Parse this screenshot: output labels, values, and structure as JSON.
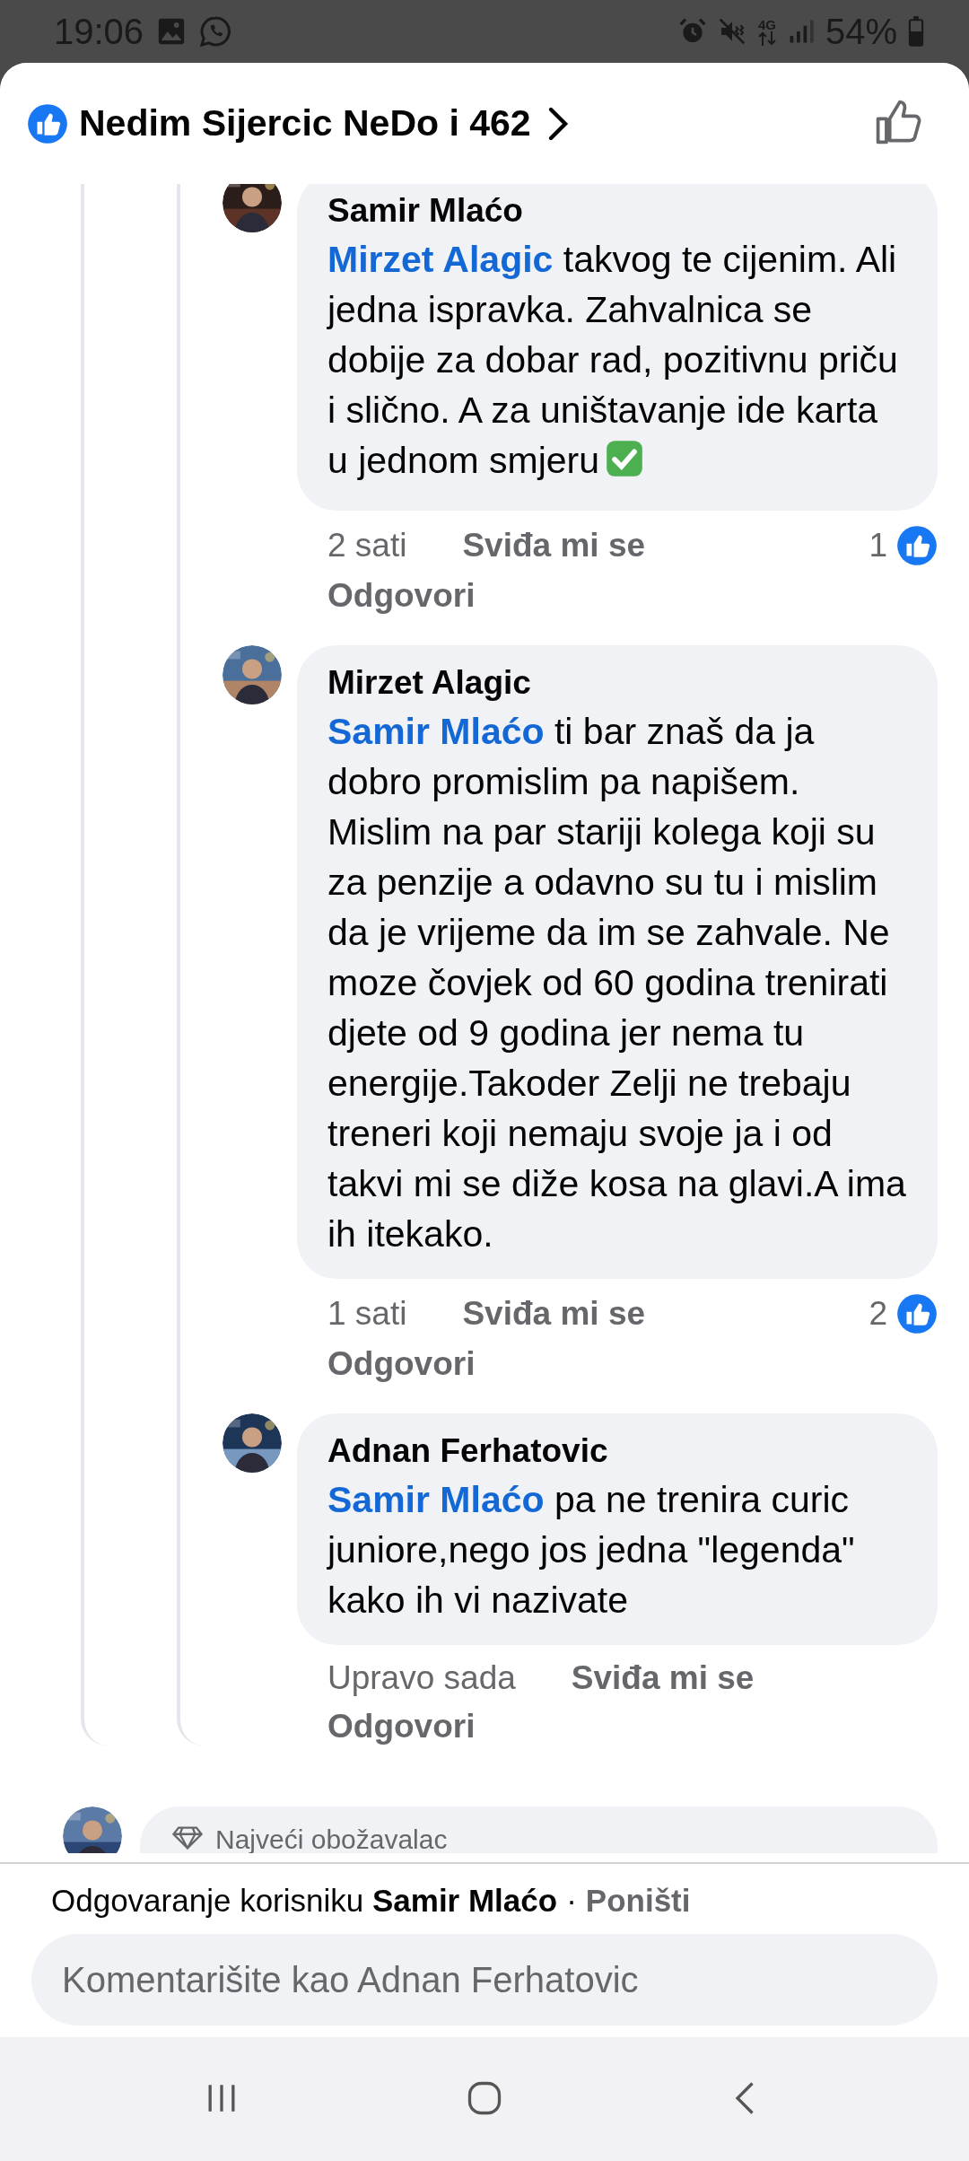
{
  "status_bar": {
    "time": "19:06",
    "network": "4G",
    "battery": "54%"
  },
  "header": {
    "title": "Nedim Sijercic NeDo i 462"
  },
  "comments": [
    {
      "author": "Samir Mlaćo",
      "mention": "Mirzet Alagic",
      "text": " takvog te cijenim. Ali jedna ispravka. Zahvalnica se dobije za dobar rad, pozitivnu priču i slično. A za uništavanje ide karta u jednom smjeru",
      "check_emoji": true,
      "time": "2 sati",
      "like_label": "Sviđa mi se",
      "reply_label": "Odgovori",
      "reactions": "1"
    },
    {
      "author": "Mirzet Alagic",
      "mention": "Samir Mlaćo",
      "text": " ti bar znaš da ja dobro promislim pa napišem. Mislim na par stariji kolega koji su za penzije a odavno su tu i mislim da je vrijeme da im se zahvale. Ne moze čovjek od 60 godina trenirati djete od 9 godina jer nema tu energije.Takoder Zelji ne trebaju treneri koji nemaju svoje ja i od takvi mi se diže kosa na glavi.A ima ih itekako.",
      "check_emoji": false,
      "time": "1 sati",
      "like_label": "Sviđa mi se",
      "reply_label": "Odgovori",
      "reactions": "2"
    },
    {
      "author": "Adnan Ferhatovic",
      "mention": "Samir Mlaćo",
      "text": " pa ne trenira curic juniore,nego jos jedna \"legenda\" kako ih vi nazivate",
      "check_emoji": false,
      "time": "Upravo sada",
      "like_label": "Sviđa mi se",
      "reply_label": "Odgovori"
    }
  ],
  "partial_comment": {
    "badge": "Najveći obožavalac"
  },
  "reply_bar": {
    "prefix": "Odgovaranje korisniku",
    "name": "Samir Mlaćo",
    "separator": "·",
    "cancel": "Poništi",
    "placeholder": "Komentarišite kao Adnan Ferhatovic"
  }
}
